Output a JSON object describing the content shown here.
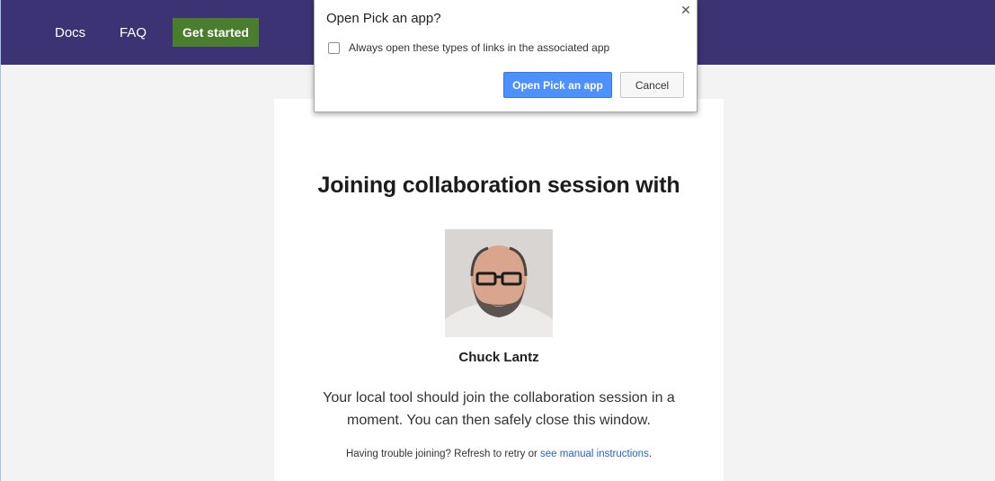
{
  "nav": {
    "docs_label": "Docs",
    "faq_label": "FAQ",
    "cta_label": "Get started"
  },
  "dialog": {
    "title": "Open Pick an app?",
    "close_glyph": "✕",
    "checkbox_label": "Always open these types of links in the associated app",
    "checkbox_checked": false,
    "open_button_label": "Open Pick an app",
    "cancel_button_label": "Cancel"
  },
  "session": {
    "heading": "Joining collaboration session with",
    "host_name": "Chuck Lantz",
    "message": "Your local tool should join the collaboration session in a moment. You can then safely close this window.",
    "trouble_prefix": "Having trouble joining? Refresh to retry or ",
    "manual_link": "see manual instructions",
    "trouble_suffix": "."
  },
  "colors": {
    "nav_bg": "#3c3375",
    "cta_bg": "#4a7d2e",
    "page_bg": "#f3f3f3",
    "link": "#2a62c8",
    "primary_button": "#4d90fe"
  }
}
